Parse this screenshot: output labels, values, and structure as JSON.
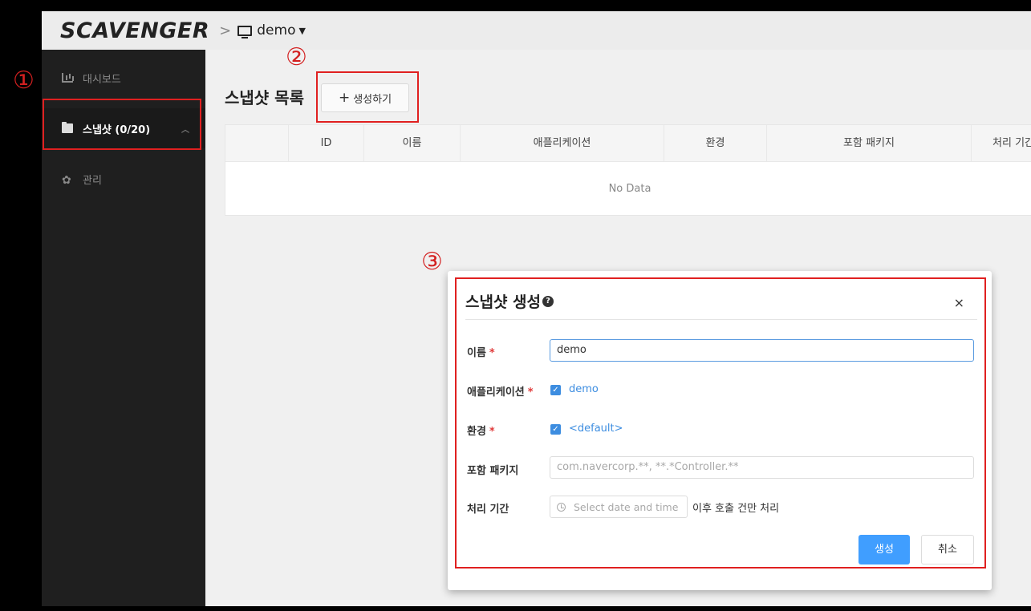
{
  "app": {
    "logo": "SCAVENGER",
    "breadcrumb_sep": ">",
    "project": "demo"
  },
  "sidebar": {
    "items": [
      {
        "label": "대시보드",
        "icon": "chart-icon"
      },
      {
        "label": "스냅샷 (0/20)",
        "icon": "folder-icon",
        "active": true
      },
      {
        "label": "관리",
        "icon": "gear-icon"
      }
    ]
  },
  "main": {
    "title": "스냅샷 목록",
    "create_label": "생성하기",
    "columns": [
      "ID",
      "이름",
      "애플리케이션",
      "환경",
      "포함 패키지",
      "처리 기간"
    ],
    "empty_text": "No Data"
  },
  "annotations": [
    "①",
    "②",
    "③"
  ],
  "dialog": {
    "title": "스냅샷 생성",
    "close": "×",
    "help": "?",
    "fields": {
      "name_label": "이름",
      "name_value": "demo",
      "app_label": "애플리케이션",
      "app_value": "demo",
      "env_label": "환경",
      "env_value": "<default>",
      "pkg_label": "포함 패키지",
      "pkg_placeholder": "com.navercorp.**, **.*Controller.**",
      "period_label": "처리 기간",
      "period_placeholder": "Select date and time",
      "period_suffix": "이후 호출 건만 처리"
    },
    "required_mark": "*",
    "submit_label": "생성",
    "cancel_label": "취소"
  },
  "colors": {
    "primary": "#409eff",
    "annotation": "#e02020",
    "sidebar_bg": "#1f1f1f"
  }
}
